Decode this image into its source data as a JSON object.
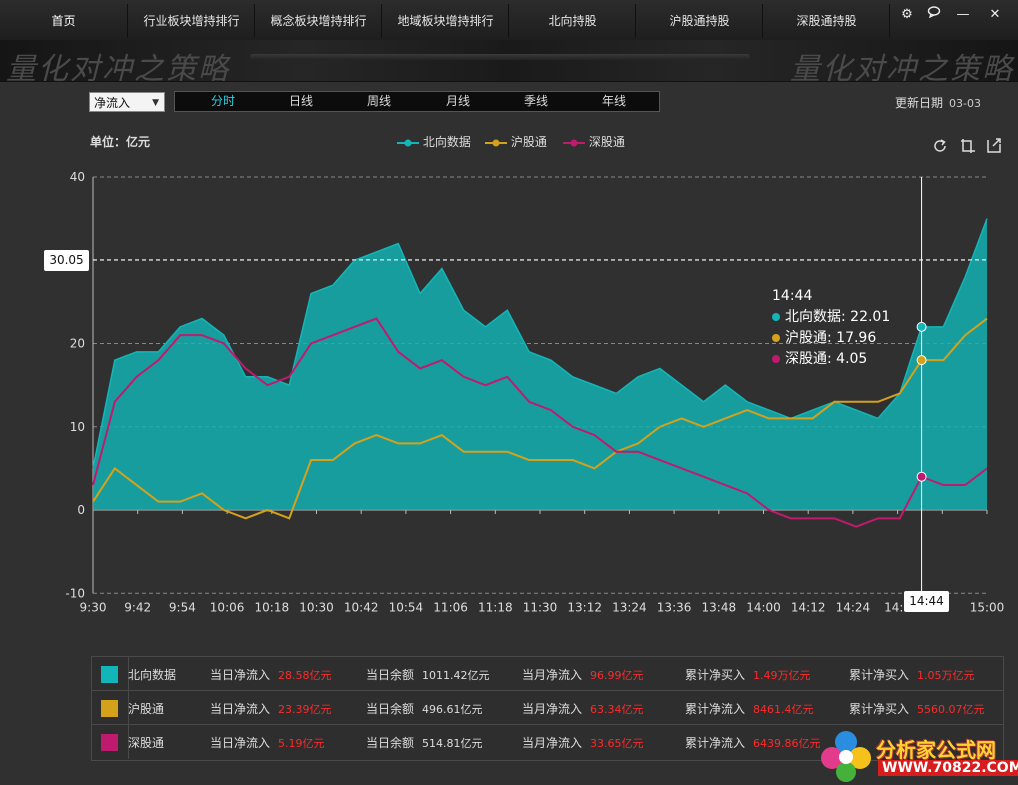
{
  "nav": {
    "tabs": [
      "首页",
      "行业板块增持排行",
      "概念板块增持排行",
      "地域板块增持排行",
      "北向持股",
      "沪股通持股",
      "深股通持股"
    ],
    "controls": [
      "⚙",
      "💬",
      "—",
      "✕"
    ]
  },
  "banner": {
    "watermark": "量化对冲之策略"
  },
  "toolbar": {
    "select_value": "净流入",
    "periods": [
      "分时",
      "日线",
      "周线",
      "月线",
      "季线",
      "年线"
    ],
    "active_period": "分时",
    "update_label": "更新日期",
    "update_value": "03-03"
  },
  "chart_header": {
    "unit": "单位：亿元",
    "legend": [
      "北向数据",
      "沪股通",
      "深股通"
    ]
  },
  "tooltip": {
    "time": "14:44",
    "lines": [
      "北向数据: 22.01",
      "沪股通: 17.96",
      "深股通: 4.05"
    ]
  },
  "crosshair": {
    "y_value": "30.05",
    "x_value": "14:44"
  },
  "colors": {
    "north": "#13b6b8",
    "sh": "#d4a21a",
    "sz": "#c01a6e"
  },
  "chart_data": {
    "type": "area",
    "y_ticks": [
      "40",
      "30",
      "20",
      "10",
      "0",
      "-10"
    ],
    "ylim": [
      -10,
      40
    ],
    "x_ticks": [
      "9:30",
      "9:42",
      "9:54",
      "10:06",
      "10:18",
      "10:30",
      "10:42",
      "10:54",
      "11:06",
      "11:18",
      "11:30",
      "13:12",
      "13:24",
      "13:36",
      "13:48",
      "14:00",
      "14:12",
      "14:24",
      "14:3",
      "8",
      "15:00"
    ],
    "x": [
      "9:30",
      "9:36",
      "9:42",
      "9:48",
      "9:54",
      "10:00",
      "10:06",
      "10:12",
      "10:18",
      "10:24",
      "10:30",
      "10:36",
      "10:42",
      "10:48",
      "10:54",
      "11:00",
      "11:06",
      "11:12",
      "11:18",
      "11:24",
      "11:30",
      "13:06",
      "13:12",
      "13:18",
      "13:24",
      "13:30",
      "13:36",
      "13:42",
      "13:48",
      "13:54",
      "14:00",
      "14:06",
      "14:12",
      "14:18",
      "14:24",
      "14:30",
      "14:36",
      "14:42",
      "14:44",
      "14:48",
      "14:54",
      "15:00"
    ],
    "series": [
      {
        "name": "北向数据",
        "values": [
          5,
          18,
          19,
          19,
          22,
          23,
          21,
          16,
          16,
          15,
          26,
          27,
          30,
          31,
          32,
          26,
          29,
          24,
          22,
          24,
          19,
          18,
          16,
          15,
          14,
          16,
          17,
          15,
          13,
          15,
          13,
          12,
          11,
          12,
          13,
          12,
          11,
          14,
          22,
          22,
          28,
          35
        ]
      },
      {
        "name": "沪股通",
        "values": [
          1,
          5,
          3,
          1,
          1,
          2,
          0,
          -1,
          0,
          -1,
          6,
          6,
          8,
          9,
          8,
          8,
          9,
          7,
          7,
          7,
          6,
          6,
          6,
          5,
          7,
          8,
          10,
          11,
          10,
          11,
          12,
          11,
          11,
          11,
          13,
          13,
          13,
          14,
          18,
          18,
          21,
          23
        ]
      },
      {
        "name": "深股通",
        "values": [
          3,
          13,
          16,
          18,
          21,
          21,
          20,
          17,
          15,
          16,
          20,
          21,
          22,
          23,
          19,
          17,
          18,
          16,
          15,
          16,
          13,
          12,
          10,
          9,
          7,
          7,
          6,
          5,
          4,
          3,
          2,
          0,
          -1,
          -1,
          -1,
          -2,
          -1,
          -1,
          4,
          3,
          3,
          5
        ]
      }
    ]
  },
  "table": {
    "rows": [
      {
        "name": "北向数据",
        "cells": [
          {
            "label": "当日净流入",
            "value": "28.58亿元",
            "red": true
          },
          {
            "label": "当日余额",
            "value": "1011.42亿元",
            "red": false
          },
          {
            "label": "当月净流入",
            "value": "96.99亿元",
            "red": true
          },
          {
            "label": "累计净买入",
            "value": "1.49万亿元",
            "red": true
          },
          {
            "label": "累计净买入",
            "value": "1.05万亿元",
            "red": true
          }
        ]
      },
      {
        "name": "沪股通",
        "cells": [
          {
            "label": "当日净流入",
            "value": "23.39亿元",
            "red": true
          },
          {
            "label": "当日余额",
            "value": "496.61亿元",
            "red": false
          },
          {
            "label": "当月净流入",
            "value": "63.34亿元",
            "red": true
          },
          {
            "label": "累计净流入",
            "value": "8461.4亿元",
            "red": true
          },
          {
            "label": "累计净买入",
            "value": "5560.07亿元",
            "red": true
          }
        ]
      },
      {
        "name": "深股通",
        "cells": [
          {
            "label": "当日净流入",
            "value": "5.19亿元",
            "red": true
          },
          {
            "label": "当日余额",
            "value": "514.81亿元",
            "red": false
          },
          {
            "label": "当月净流入",
            "value": "33.65亿元",
            "red": true
          },
          {
            "label": "累计净流入",
            "value": "6439.86亿元",
            "red": true
          }
        ]
      }
    ]
  },
  "logo": {
    "title": "分析家公式网",
    "url": "WWW.70822.COM"
  }
}
